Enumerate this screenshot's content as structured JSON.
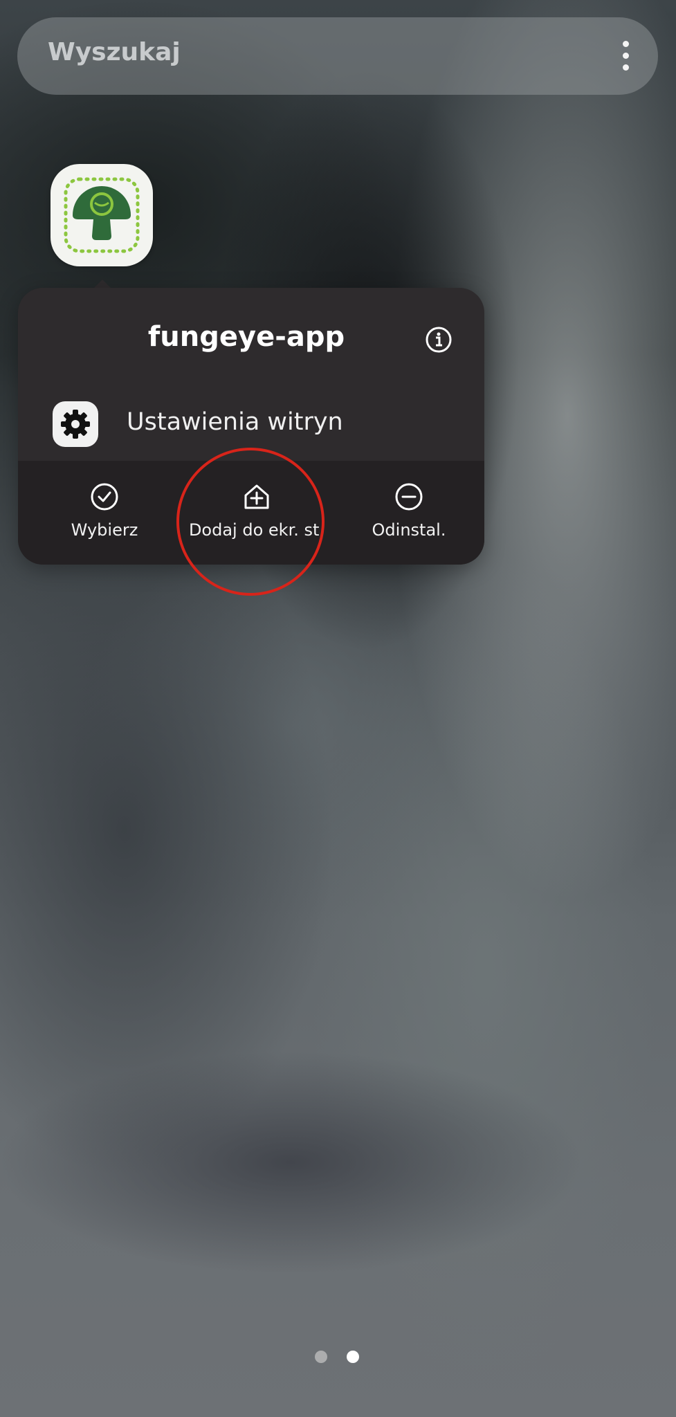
{
  "search": {
    "placeholder": "Wyszukaj",
    "more_icon": "more-vertical-icon"
  },
  "app": {
    "icon": "mushroom-icon",
    "accent_color": "#2f6b3a",
    "accent_light": "#8cc63f"
  },
  "popup": {
    "title": "fungeye-app",
    "info_icon": "info-icon",
    "shortcut": {
      "label": "Ustawienia witryn",
      "icon": "gear-icon"
    },
    "actions": [
      {
        "label": "Wybierz",
        "icon": "check-circle-icon"
      },
      {
        "label": "Dodaj do ekr. st.",
        "icon": "add-home-icon"
      },
      {
        "label": "Odinstal.",
        "icon": "minus-circle-icon"
      }
    ]
  },
  "annotation": {
    "color": "#d8241a"
  },
  "pages": {
    "count": 2,
    "active": 2
  }
}
